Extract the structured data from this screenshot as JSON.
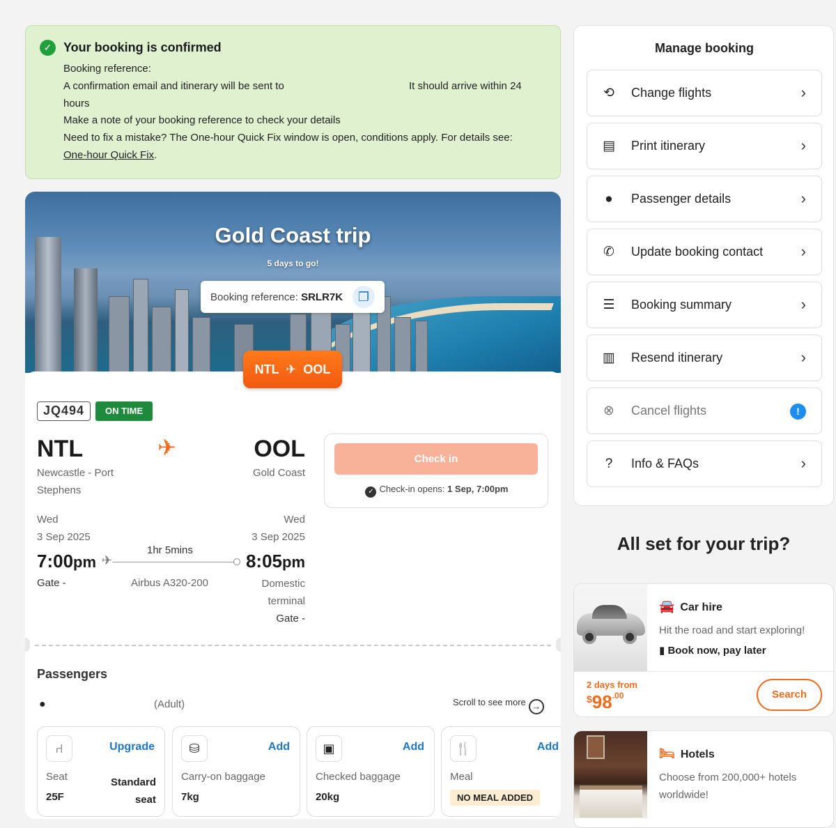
{
  "confirmation": {
    "title": "Your booking is confirmed",
    "line1": "Booking reference:",
    "line2a": "A confirmation email and itinerary will be sent to",
    "line2b": "It should arrive within 24",
    "line3": "hours",
    "line4": "Make a note of your booking reference to check your details",
    "line5": "Need to fix a mistake? The One-hour Quick Fix window is open, conditions apply. For details see:",
    "link": "One-hour Quick Fix"
  },
  "trip": {
    "title": "Gold Coast trip",
    "countdown": "5 days to go!",
    "booking_ref_label": "Booking reference:",
    "booking_ref": "SRLR7K",
    "route_from": "NTL",
    "route_to": "OOL",
    "flight_number": "JQ494",
    "status": "ON TIME",
    "origin": {
      "code": "NTL",
      "city_line1": "Newcastle - Port",
      "city_line2": "Stephens",
      "day": "Wed",
      "date": "3 Sep 2025",
      "time": "7:00",
      "ampm": "pm",
      "gate": "Gate -"
    },
    "destination": {
      "code": "OOL",
      "city": "Gold Coast",
      "day": "Wed",
      "date": "3 Sep 2025",
      "time": "8:05",
      "ampm": "pm",
      "terminal_line1": "Domestic",
      "terminal_line2": "terminal",
      "gate": "Gate -"
    },
    "duration": "1hr 5mins",
    "aircraft": "Airbus A320-200",
    "checkin": {
      "button": "Check in",
      "note_label": "Check-in opens:",
      "note_value": "1 Sep, 7:00pm"
    }
  },
  "passengers": {
    "title": "Passengers",
    "type": "(Adult)",
    "scroll_hint": "Scroll to see more",
    "addons": [
      {
        "icon": "seat-icon",
        "action": "Upgrade",
        "name": "Seat",
        "value": "25F",
        "right1": "Standard",
        "right2": "seat"
      },
      {
        "icon": "carry-on-bag-icon",
        "action": "Add",
        "name": "Carry-on baggage",
        "value": "7kg"
      },
      {
        "icon": "checked-bag-icon",
        "action": "Add",
        "name": "Checked baggage",
        "value": "20kg"
      },
      {
        "icon": "meal-icon",
        "action": "Add",
        "name": "Meal",
        "badge": "NO MEAL ADDED"
      }
    ]
  },
  "manage": {
    "title": "Manage booking",
    "items": [
      {
        "label": "Change flights",
        "icon": "change-flights-icon"
      },
      {
        "label": "Print itinerary",
        "icon": "print-itinerary-icon"
      },
      {
        "label": "Passenger details",
        "icon": "passenger-icon"
      },
      {
        "label": "Update booking contact",
        "icon": "phone-icon"
      },
      {
        "label": "Booking summary",
        "icon": "list-icon"
      },
      {
        "label": "Resend itinerary",
        "icon": "resend-icon"
      },
      {
        "label": "Cancel flights",
        "icon": "cancel-icon"
      },
      {
        "label": "Info & FAQs",
        "icon": "info-faq-icon"
      }
    ]
  },
  "promos": {
    "title": "All set for your trip?",
    "car": {
      "title": "Car hire",
      "desc": "Hit the road and start exploring!",
      "book": "Book now, pay later",
      "from": "2 days from",
      "currency": "$",
      "price": "98",
      "cents": ".00",
      "cta": "Search"
    },
    "hotels": {
      "title": "Hotels",
      "desc1": "Choose from 200,000+ hotels",
      "desc2": "worldwide!"
    }
  },
  "colors": {
    "accent": "#f26b1d",
    "success": "#1e8a3b",
    "link": "#1d76c9",
    "confirm_bg": "#dff1cf"
  }
}
